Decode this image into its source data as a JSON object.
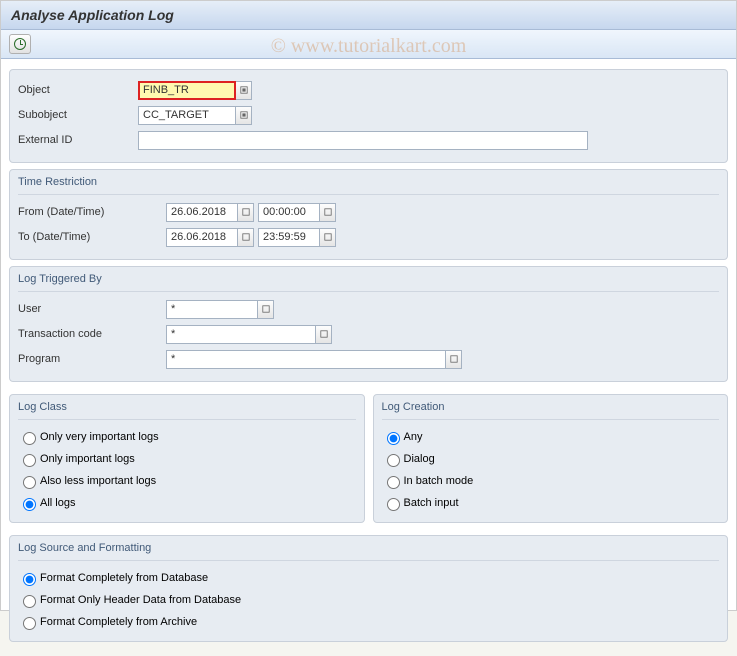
{
  "window": {
    "title": "Analyse Application Log"
  },
  "watermark": "© www.tutorialkart.com",
  "fields": {
    "object_label": "Object",
    "object_value": "FINB_TR",
    "subobject_label": "Subobject",
    "subobject_value": "CC_TARGET",
    "externalid_label": "External ID",
    "externalid_value": ""
  },
  "time": {
    "title": "Time Restriction",
    "from_label": "From (Date/Time)",
    "from_date": "26.06.2018",
    "from_time": "00:00:00",
    "to_label": "To (Date/Time)",
    "to_date": "26.06.2018",
    "to_time": "23:59:59"
  },
  "trigger": {
    "title": "Log Triggered By",
    "user_label": "User",
    "user_value": "*",
    "tcode_label": "Transaction code",
    "tcode_value": "*",
    "program_label": "Program",
    "program_value": "*"
  },
  "logclass": {
    "title": "Log Class",
    "opt1": "Only very important logs",
    "opt2": "Only important logs",
    "opt3": "Also less important logs",
    "opt4": "All logs"
  },
  "logcreation": {
    "title": "Log Creation",
    "opt1": "Any",
    "opt2": "Dialog",
    "opt3": "In batch mode",
    "opt4": "Batch input"
  },
  "source": {
    "title": "Log Source and Formatting",
    "opt1": "Format Completely from Database",
    "opt2": "Format Only Header Data from Database",
    "opt3": "Format Completely from Archive"
  }
}
